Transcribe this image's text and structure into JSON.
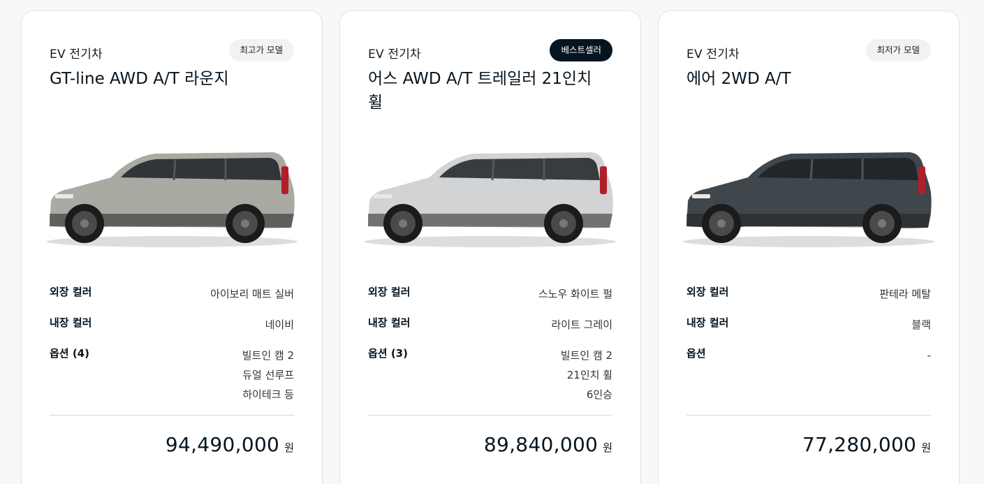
{
  "cards": [
    {
      "category": "EV 전기차",
      "badge": "최고가 모델",
      "badge_style": "light",
      "model": "GT-line AWD A/T 라운지",
      "car_color": "#a9aaa2",
      "specs": {
        "exterior_label": "외장 컬러",
        "exterior_value": "아이보리 매트 실버",
        "interior_label": "내장 컬러",
        "interior_value": "네이비",
        "options_label": "옵션 (4)",
        "options": [
          "빌트인 캠 2",
          "듀얼 선루프",
          "하이테크 등"
        ]
      },
      "price": "94,490,000",
      "price_unit": "원"
    },
    {
      "category": "EV 전기차",
      "badge": "베스트셀러",
      "badge_style": "dark",
      "model": "어스 AWD A/T 트레일러 21인치 휠",
      "car_color": "#d2d3d4",
      "specs": {
        "exterior_label": "외장 컬러",
        "exterior_value": "스노우 화이트 펄",
        "interior_label": "내장 컬러",
        "interior_value": "라이트 그레이",
        "options_label": "옵션 (3)",
        "options": [
          "빌트인 캠 2",
          "21인치 휠",
          "6인승"
        ]
      },
      "price": "89,840,000",
      "price_unit": "원"
    },
    {
      "category": "EV 전기차",
      "badge": "최저가 모델",
      "badge_style": "light",
      "model": "에어 2WD A/T",
      "car_color": "#3f464c",
      "specs": {
        "exterior_label": "외장 컬러",
        "exterior_value": "판테라 메탈",
        "interior_label": "내장 컬러",
        "interior_value": "블랙",
        "options_label": "옵션",
        "options": [
          "-"
        ]
      },
      "price": "77,280,000",
      "price_unit": "원"
    }
  ]
}
